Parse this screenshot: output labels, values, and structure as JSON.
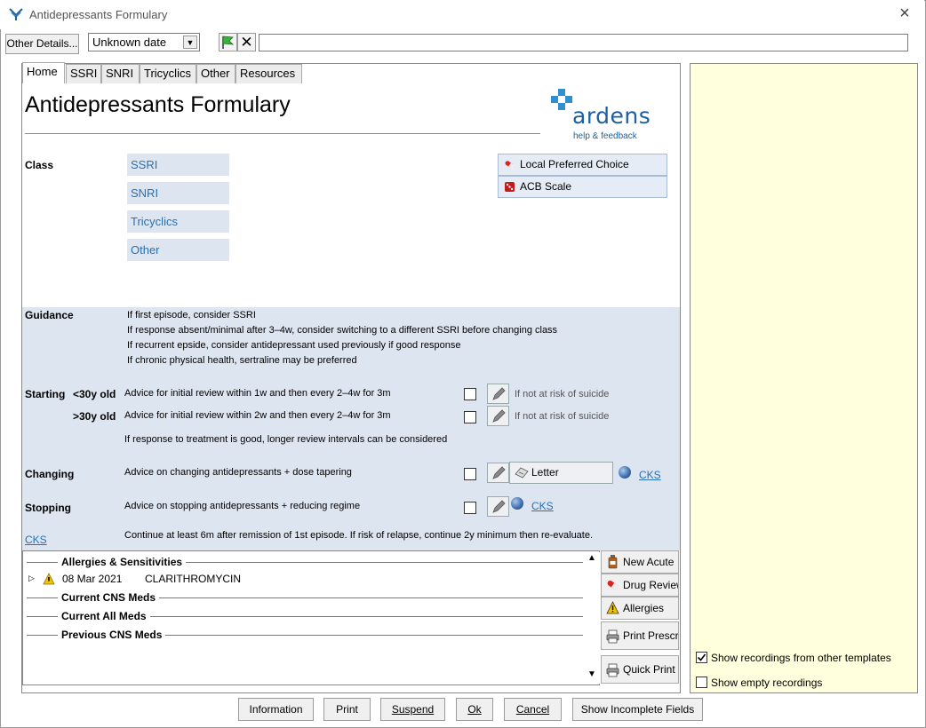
{
  "window": {
    "title": "Antidepressants Formulary",
    "close_label": "×"
  },
  "toolbar": {
    "other_details_label": "Other Details...",
    "date_value": "Unknown date",
    "comment_value": ""
  },
  "tabs": [
    {
      "label": "Home",
      "active": true
    },
    {
      "label": "SSRI"
    },
    {
      "label": "SNRI"
    },
    {
      "label": "Tricyclics"
    },
    {
      "label": "Other"
    },
    {
      "label": "Resources"
    }
  ],
  "page_title": "Antidepressants Formulary",
  "logo": {
    "name": "ardens",
    "sub": "help & feedback"
  },
  "class_section": {
    "label": "Class",
    "buttons": [
      "SSRI",
      "SNRI",
      "Tricyclics",
      "Other"
    ]
  },
  "side_buttons": [
    "Local Preferred Choice",
    "ACB Scale"
  ],
  "guidance": {
    "label": "Guidance",
    "lines": [
      "If first episode, consider SSRI",
      "If response absent/minimal after 3–4w, consider switching to a different SSRI before changing class",
      "If recurrent epside, consider antidepressant used previously if good response",
      "If chronic physical health, sertraline may be preferred"
    ]
  },
  "starting": {
    "label": "Starting",
    "row1": {
      "age": "<30y old",
      "text": "Advice for initial review within 1w and then every 2–4w for 3m",
      "note": "If not at risk of suicide"
    },
    "row2": {
      "age": ">30y old",
      "text": "Advice for initial review within 2w and then every 2–4w for 3m",
      "note": "If not at risk of suicide"
    },
    "footer": "If response to treatment is good, longer review intervals can be considered"
  },
  "changing": {
    "label": "Changing",
    "text": "Advice on changing antidepressants + dose tapering",
    "letter_label": "Letter",
    "link": "CKS"
  },
  "stopping": {
    "label": "Stopping",
    "text": "Advice on stopping antidepressants + reducing regime",
    "link": "CKS"
  },
  "cks": {
    "link": "CKS",
    "text": "Continue at least 6m after remission of 1st episode. If risk of relapse, continue 2y minimum then re-evaluate."
  },
  "meds": {
    "sections": [
      "Allergies & Sensitivities",
      "Current CNS Meds",
      "Current All Meds",
      "Previous CNS Meds"
    ],
    "allergy_entry": {
      "date": "08 Mar 2021",
      "name": "CLARITHROMYCIN"
    }
  },
  "actions": [
    "New Acute",
    "Drug Review",
    "Allergies",
    "Print Prescri...",
    "Quick Print ..."
  ],
  "right_panel": {
    "show_other_templates": {
      "label": "Show recordings from other templates",
      "checked": true
    },
    "show_empty": {
      "label": "Show empty recordings",
      "checked": false
    }
  },
  "bottom_buttons": [
    "Information",
    "Print",
    "Suspend",
    "Ok",
    "Cancel",
    "Show Incomplete Fields"
  ]
}
